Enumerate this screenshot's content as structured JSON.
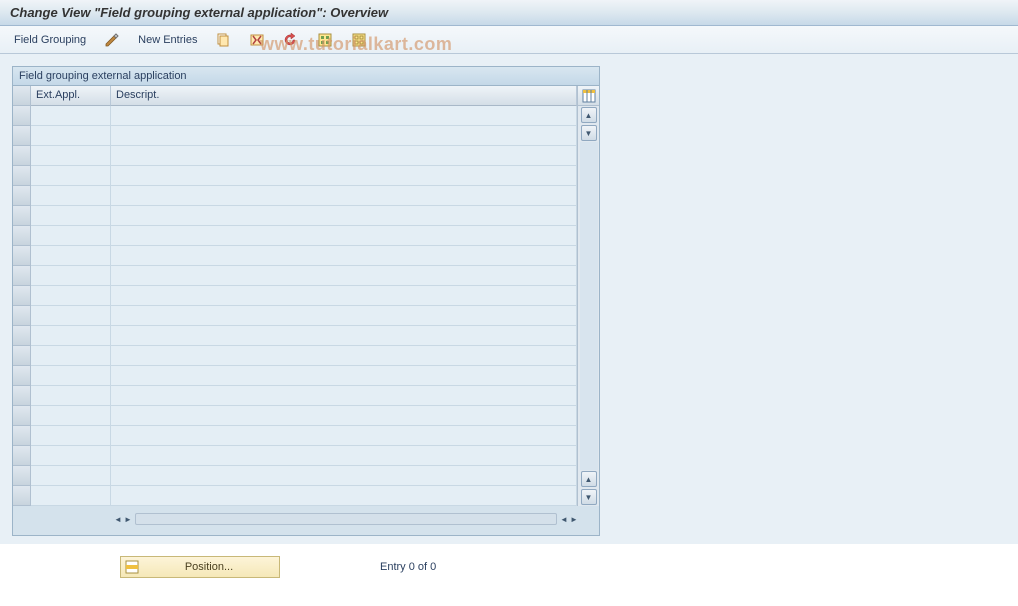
{
  "title": "Change View \"Field grouping external application\": Overview",
  "toolbar": {
    "field_grouping_label": "Field Grouping",
    "new_entries_label": "New Entries",
    "icons": {
      "edit": "edit-icon",
      "copy": "copy-icon",
      "delete": "delete-icon",
      "undo": "undo-icon",
      "select_all": "select-all-icon",
      "deselect_all": "deselect-all-icon"
    }
  },
  "watermark": "www.tutorialkart.com",
  "table": {
    "title": "Field grouping external application",
    "columns": {
      "ext_appl": "Ext.Appl.",
      "descript": "Descript."
    },
    "rows": [
      {
        "ext_appl": "",
        "descript": ""
      },
      {
        "ext_appl": "",
        "descript": ""
      },
      {
        "ext_appl": "",
        "descript": ""
      },
      {
        "ext_appl": "",
        "descript": ""
      },
      {
        "ext_appl": "",
        "descript": ""
      },
      {
        "ext_appl": "",
        "descript": ""
      },
      {
        "ext_appl": "",
        "descript": ""
      },
      {
        "ext_appl": "",
        "descript": ""
      },
      {
        "ext_appl": "",
        "descript": ""
      },
      {
        "ext_appl": "",
        "descript": ""
      },
      {
        "ext_appl": "",
        "descript": ""
      },
      {
        "ext_appl": "",
        "descript": ""
      },
      {
        "ext_appl": "",
        "descript": ""
      },
      {
        "ext_appl": "",
        "descript": ""
      },
      {
        "ext_appl": "",
        "descript": ""
      },
      {
        "ext_appl": "",
        "descript": ""
      },
      {
        "ext_appl": "",
        "descript": ""
      },
      {
        "ext_appl": "",
        "descript": ""
      },
      {
        "ext_appl": "",
        "descript": ""
      },
      {
        "ext_appl": "",
        "descript": ""
      }
    ]
  },
  "footer": {
    "position_label": "Position...",
    "entry_text": "Entry 0 of 0"
  }
}
